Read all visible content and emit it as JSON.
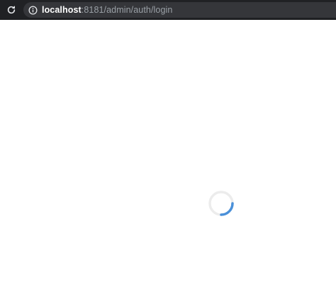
{
  "browser": {
    "url_host": "localhost",
    "url_rest": ":8181/admin/auth/login",
    "reload_icon": "reload-icon",
    "info_icon": "info-icon"
  },
  "page": {
    "spinner_icon": "loading-spinner-icon",
    "spinner_track_color": "#ececec",
    "spinner_arc_color": "#4a90d9"
  }
}
